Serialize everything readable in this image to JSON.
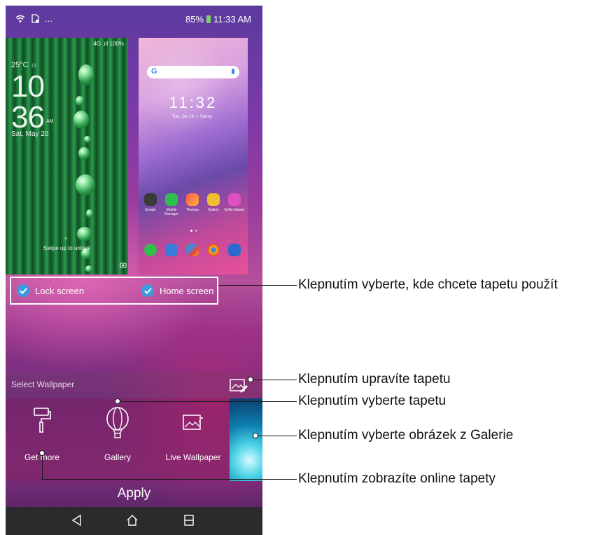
{
  "status_bar": {
    "battery": "85%",
    "time": "11:33 AM",
    "overflow": "..."
  },
  "lock_preview": {
    "status": "4G .ıll 100%",
    "temp": "25°C ☼",
    "hour": "10",
    "minute": "36",
    "ampm": "AM",
    "date": "Sat, May 20",
    "swipe": "Swipe up to unlock"
  },
  "home_preview": {
    "clock": "11:32",
    "date": "Tue, Jan 16  ☼ Sunny ·",
    "apps": [
      "Google",
      "Mobile Manager",
      "Themes",
      "Gallery",
      "Selfie Master"
    ]
  },
  "targets": {
    "lock": "Lock screen",
    "home": "Home screen"
  },
  "select": {
    "label": "Select Wallpaper",
    "options": [
      {
        "label": "Get more",
        "icon": "paint-roller-icon"
      },
      {
        "label": "Gallery",
        "icon": "balloon-icon"
      },
      {
        "label": "Live Wallpaper",
        "icon": "live-wallpaper-icon"
      }
    ]
  },
  "apply": "Apply",
  "callouts": [
    "Klepnutím vyberte, kde chcete tapetu použít",
    "Klepnutím upravíte tapetu",
    "Klepnutím vyberte tapetu",
    "Klepnutím vyberte obrázek z Galerie",
    "Klepnutím zobrazíte online tapety"
  ],
  "colors": {
    "checkbox": "#3b9be0",
    "navbar": "#2b2b2e",
    "callout_text": "#111111"
  }
}
